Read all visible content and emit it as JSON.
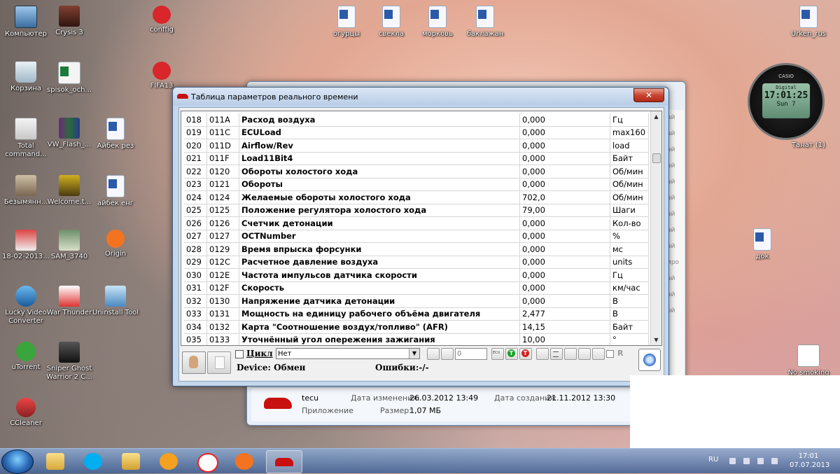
{
  "desktop": {
    "icons": [
      {
        "label": "Компьютер"
      },
      {
        "label": "Crysis 3"
      },
      {
        "label": "conffig"
      },
      {
        "label": "огурцы"
      },
      {
        "label": "свекла"
      },
      {
        "label": "морковь"
      },
      {
        "label": "баклажан"
      },
      {
        "label": "Urken_rus"
      },
      {
        "label": "Корзина"
      },
      {
        "label": "spisok_och..."
      },
      {
        "label": "FIFA13"
      },
      {
        "label": "Total command..."
      },
      {
        "label": "VW_Flash_..."
      },
      {
        "label": "Айбек рез"
      },
      {
        "label": "Безымянн..."
      },
      {
        "label": "Welcome.t..."
      },
      {
        "label": "айбек енг"
      },
      {
        "label": "18-02-2013..."
      },
      {
        "label": "SAM_3740"
      },
      {
        "label": "Origin"
      },
      {
        "label": "Lucky Video Converter"
      },
      {
        "label": "War Thunder"
      },
      {
        "label": "Uninstall Tool"
      },
      {
        "label": "uTorrent"
      },
      {
        "label": "Sniper Ghost Warrior 2 C..."
      },
      {
        "label": "CCleaner"
      },
      {
        "label": "Танат (1)"
      },
      {
        "label": "док"
      },
      {
        "label": "No smoking"
      }
    ]
  },
  "clock": {
    "brand": "CASIO",
    "line1": "Digital",
    "time": "17:01:25",
    "day": "Sun  7"
  },
  "explorer": {
    "side_labels": [
      "ай",
      "ай",
      "ай",
      "ай",
      "ай",
      "ай",
      "ай",
      "ай",
      "ай",
      "иро",
      "ай",
      "ай",
      "ой"
    ],
    "detail": {
      "name": "tecu",
      "type": "Приложение",
      "modified_label": "Дата изменения:",
      "modified_value": "26.03.2012 13:49",
      "created_label": "Дата создания:",
      "created_value": "21.11.2012 13:30",
      "size_label": "Размер:",
      "size_value": "1,07 МБ"
    }
  },
  "window": {
    "title": "Таблица параметров реального времени",
    "close_label": "✕",
    "rows": [
      {
        "num": "018",
        "code": "011A",
        "name": "Расход воздуха",
        "value": "0,000",
        "unit": "Гц"
      },
      {
        "num": "019",
        "code": "011C",
        "name": "ECULoad",
        "value": "0,000",
        "unit": "max160"
      },
      {
        "num": "020",
        "code": "011D",
        "name": "Airflow/Rev",
        "value": "0,000",
        "unit": "load"
      },
      {
        "num": "021",
        "code": "011F",
        "name": "Load11Bit4",
        "value": "0,000",
        "unit": "Байт"
      },
      {
        "num": "022",
        "code": "0120",
        "name": "Обороты холостого хода",
        "value": "0,000",
        "unit": "Об/мин"
      },
      {
        "num": "023",
        "code": "0121",
        "name": "Обороты",
        "value": "0,000",
        "unit": "Об/мин"
      },
      {
        "num": "024",
        "code": "0124",
        "name": "Желаемые обороты холостого хода",
        "value": "702,0",
        "unit": "Об/мин"
      },
      {
        "num": "025",
        "code": "0125",
        "name": "Положение регулятора холостого хода",
        "value": "79,00",
        "unit": "Шаги"
      },
      {
        "num": "026",
        "code": "0126",
        "name": "Счетчик детонации",
        "value": "0,000",
        "unit": "Кол-во"
      },
      {
        "num": "027",
        "code": "0127",
        "name": "OCTNumber",
        "value": "0,000",
        "unit": "%"
      },
      {
        "num": "028",
        "code": "0129",
        "name": "Время впрыска форсунки",
        "value": "0,000",
        "unit": "мс"
      },
      {
        "num": "029",
        "code": "012C",
        "name": "Расчетное давление воздуха",
        "value": "0,000",
        "unit": "units"
      },
      {
        "num": "030",
        "code": "012E",
        "name": "Частота импульсов датчика скорости",
        "value": "0,000",
        "unit": "Гц"
      },
      {
        "num": "031",
        "code": "012F",
        "name": "Скорость",
        "value": "0,000",
        "unit": "км/час"
      },
      {
        "num": "032",
        "code": "0130",
        "name": "Напряжение датчика детонации",
        "value": "0,000",
        "unit": "В"
      },
      {
        "num": "033",
        "code": "0131",
        "name": "Мощность на единицу рабочего объёма двигателя",
        "value": "2,477",
        "unit": "В"
      },
      {
        "num": "034",
        "code": "0132",
        "name": "Карта \"Соотношение воздух/топливо\" (AFR)",
        "value": "14,15",
        "unit": "Байт"
      },
      {
        "num": "035",
        "code": "0133",
        "name": "Уточнённый угол опережения зажигания",
        "value": "10,00",
        "unit": "°"
      }
    ],
    "toolbar": {
      "cycle_label": "Цикл",
      "combo_value": "Нет",
      "number_field": "0",
      "r_label": "R",
      "device_label": "Device: Обмен",
      "errors_label": "Ошибки:-/-"
    }
  },
  "taskbar": {
    "language": "RU",
    "time": "17:01",
    "date": "07.07.2013"
  }
}
